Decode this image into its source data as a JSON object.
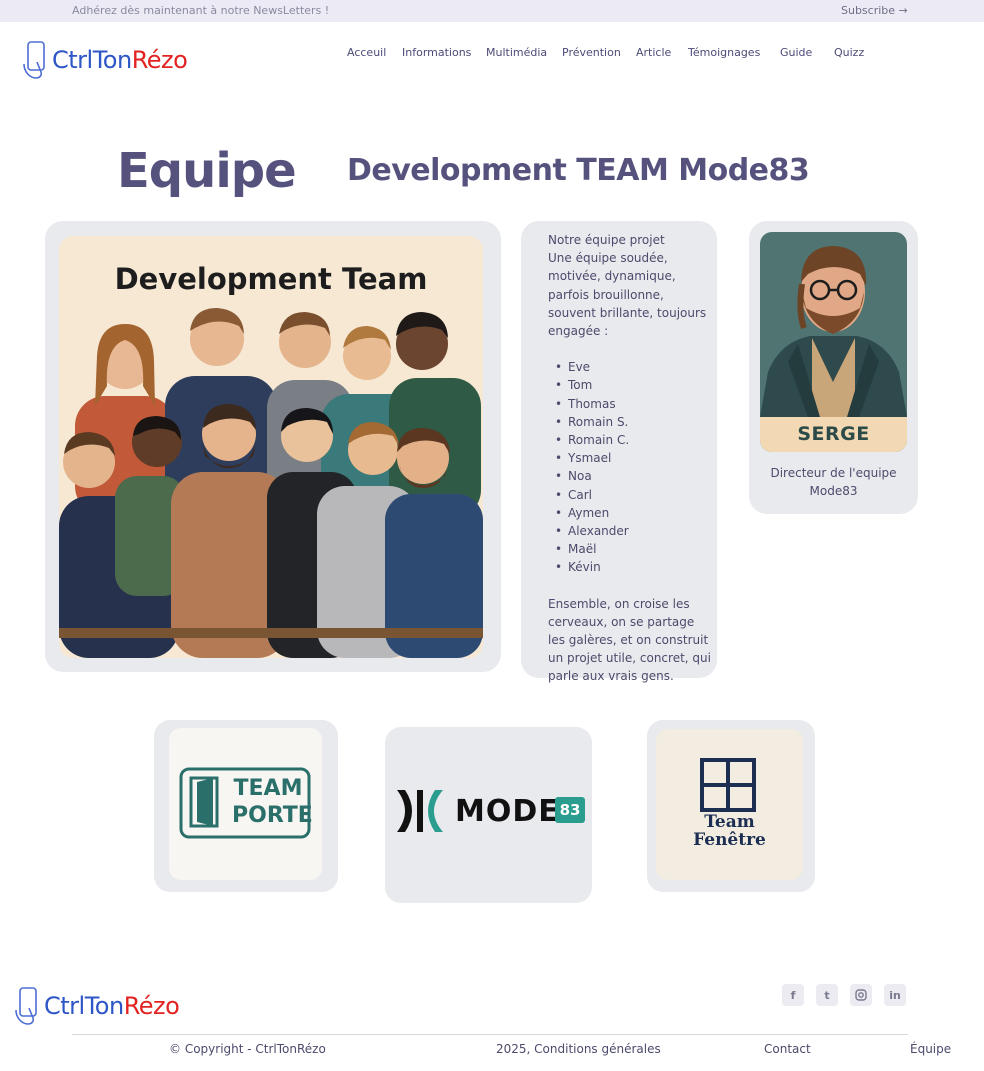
{
  "topbar": {
    "newsletter_text": "Adhérez dès maintenant à notre NewsLetters !",
    "subscribe_label": "Subscribe →"
  },
  "brand": {
    "part1": "CtrlTon",
    "part2": "Rézo"
  },
  "nav": {
    "items": [
      "Acceuil",
      "Informations",
      "Multimédia",
      "Prévention",
      "Article",
      "Témoignages",
      "Guide",
      "Quizz"
    ]
  },
  "page": {
    "title": "Equipe",
    "team_title": "Development TEAM Mode83"
  },
  "team_photo": {
    "caption": "Development Team"
  },
  "team_text": {
    "heading": "Notre équipe projet",
    "intro": "Une équipe soudée, motivée, dynamique, parfois brouillonne, souvent brillante, toujours engagée :",
    "members": [
      "Eve",
      "Tom",
      "Thomas",
      "Romain S.",
      "Romain C.",
      "Ysmael",
      "Noa",
      "Carl",
      "Aymen",
      "Alexander",
      "Maël",
      "Kévin"
    ],
    "outro": "Ensemble, on croise les cerveaux, on se partage les galères, et on construit un projet utile, concret, qui parle aux vrais gens."
  },
  "director": {
    "name": "SERGE",
    "role": "Directeur de l'equipe Mode83"
  },
  "logos": {
    "team_porte": {
      "line1": "TEAM",
      "line2": "PORTE"
    },
    "mode83": {
      "word": "MODE",
      "number": "83"
    },
    "team_fenetre": {
      "line1": "Team",
      "line2": "Fenêtre"
    }
  },
  "footer": {
    "copyright": "© Copyright - CtrlTonRézo",
    "conditions": "2025, Conditions générales",
    "contact": "Contact",
    "equipe": "Équipe",
    "social": [
      "facebook-icon",
      "twitter-icon",
      "instagram-icon",
      "linkedin-icon"
    ]
  },
  "colors": {
    "brand_blue": "#2f56c7",
    "brand_red": "#e32222",
    "heading": "#56527e",
    "card_bg": "#e9eaee",
    "topbar_bg": "#ecebf5"
  }
}
